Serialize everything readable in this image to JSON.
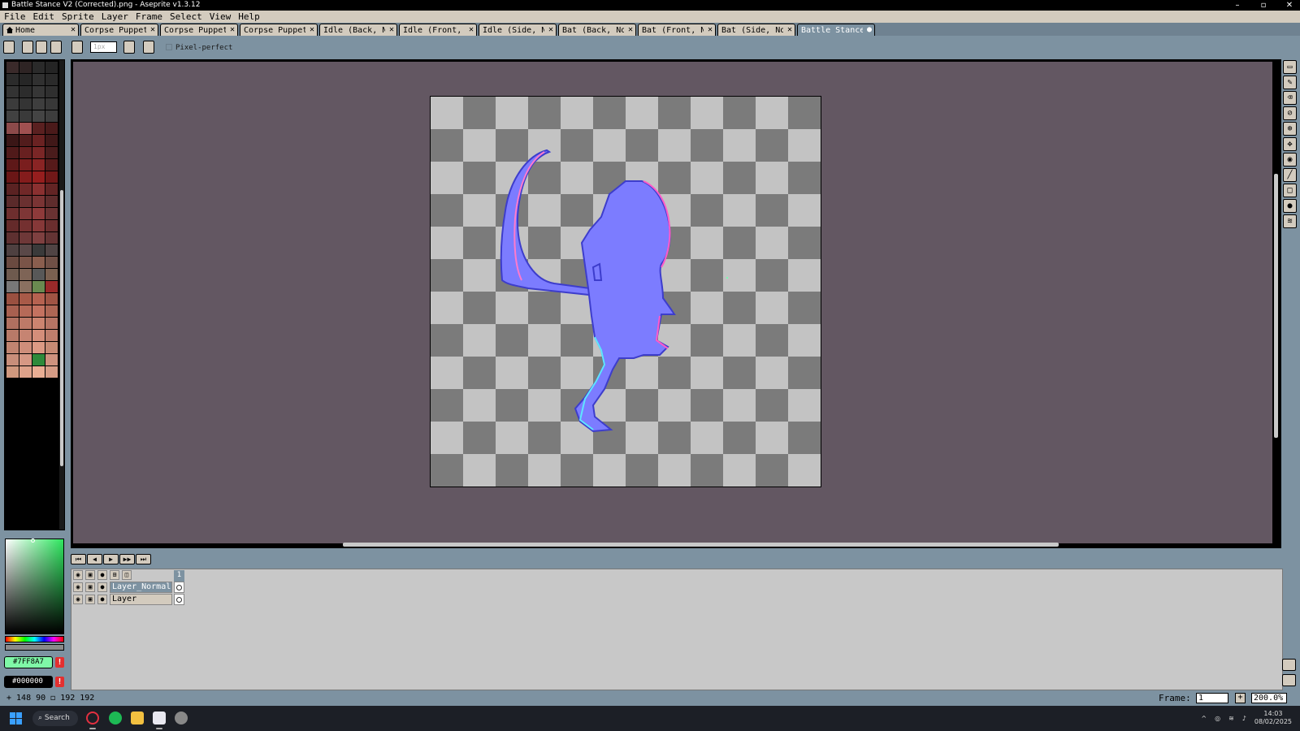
{
  "window": {
    "title": "Battle Stance V2 (Corrected).png - Aseprite v1.3.12",
    "minimize": "–",
    "maximize": "▫",
    "close": "✕"
  },
  "menu": [
    "File",
    "Edit",
    "Sprite",
    "Layer",
    "Frame",
    "Select",
    "View",
    "Help"
  ],
  "tabs": [
    {
      "label": "Home",
      "close": "✕"
    },
    {
      "label": "Corpse Puppet",
      "close": "✕"
    },
    {
      "label": "Corpse Puppet",
      "close": "✕"
    },
    {
      "label": "Corpse Puppet",
      "close": "✕"
    },
    {
      "label": "Idle (Back, Nor",
      "close": "✕"
    },
    {
      "label": "Idle (Front, Nor",
      "close": "✕"
    },
    {
      "label": "Idle (Side, Norr",
      "close": "✕"
    },
    {
      "label": "Bat (Back, Norr",
      "close": "✕"
    },
    {
      "label": "Bat (Front, Nor",
      "close": "✕"
    },
    {
      "label": "Bat (Side, Norm",
      "close": "✕"
    },
    {
      "label": "Battle Stance (",
      "close": "●"
    }
  ],
  "toolbar": {
    "brush_size": "1px",
    "pixel_perfect_label": "Pixel-perfect"
  },
  "palette_colors": [
    "#3a2a2a",
    "#2e2424",
    "#2a2a2a",
    "#242424",
    "#2b2b2b",
    "#262626",
    "#303030",
    "#2a2a2a",
    "#333333",
    "#2c2c2c",
    "#363636",
    "#2f2f2f",
    "#3b3b3b",
    "#343434",
    "#3e3e3e",
    "#383838",
    "#414141",
    "#3a3a3a",
    "#444444",
    "#3d3d3d",
    "#8c4a4a",
    "#a05050",
    "#5a2020",
    "#4a1a1a",
    "#3a1616",
    "#521c1c",
    "#6a2222",
    "#401818",
    "#501a1a",
    "#682020",
    "#7a2626",
    "#4a1c1c",
    "#5e1818",
    "#7a1e1e",
    "#8a2424",
    "#561a1a",
    "#6a1616",
    "#841c1c",
    "#961e1e",
    "#701818",
    "#5a2222",
    "#702828",
    "#8a3030",
    "#622424",
    "#5a2a2a",
    "#6a3030",
    "#7a3434",
    "#5e2c2c",
    "#6e2e2e",
    "#7e3636",
    "#8e3a3a",
    "#6a3232",
    "#642a2a",
    "#743030",
    "#863838",
    "#6a2e2e",
    "#5e3030",
    "#6e3838",
    "#7e4040",
    "#643434",
    "#4e4040",
    "#5a4848",
    "#3a3a3a",
    "#504444",
    "#6a4a40",
    "#7a5448",
    "#8a5e4e",
    "#705046",
    "#6e5a4e",
    "#7e6456",
    "#585858",
    "#7a6050",
    "#787878",
    "#8a7060",
    "#6a8a50",
    "#9a2a2a",
    "#9a5040",
    "#a85a48",
    "#b66250",
    "#a05444",
    "#a86050",
    "#b66a58",
    "#c47260",
    "#ae6654",
    "#b07060",
    "#be7a68",
    "#cc8470",
    "#b67464",
    "#b87a68",
    "#c68472",
    "#d48e7a",
    "#be7e6c",
    "#c08470",
    "#ce8e7a",
    "#dc9a84",
    "#c68a74",
    "#c88e7a",
    "#d69884",
    "#2e8a3a",
    "#ce927e",
    "#d0987e",
    "#dea28a",
    "#eaae94",
    "#d69c86"
  ],
  "colors": {
    "foreground": "#7FF8A7",
    "background": "#000000",
    "fg_label": "#7FF8A7",
    "bg_label": "#000000",
    "warn": "!"
  },
  "tools": [
    "rectangular-marquee",
    "pencil",
    "eraser",
    "eyedropper",
    "zoom",
    "move",
    "paint-bucket",
    "line",
    "rectangle",
    "blur",
    "smudge"
  ],
  "timeline": {
    "buttons": [
      "⏮",
      "◀",
      "▶",
      "▶▶",
      "⏭"
    ],
    "frame_number": "1",
    "layers": [
      {
        "name": "Layer_Normal",
        "selected": true
      },
      {
        "name": "Layer",
        "selected": false
      }
    ]
  },
  "status": {
    "position": "148  90",
    "size": "192  192",
    "frame_label": "Frame:",
    "frame_value": "1",
    "add_frame": "+",
    "zoom": "200.0%"
  },
  "taskbar": {
    "search_label": "Search",
    "time": "14:03",
    "date": "08/02/2025",
    "tray_chevron": "^"
  }
}
